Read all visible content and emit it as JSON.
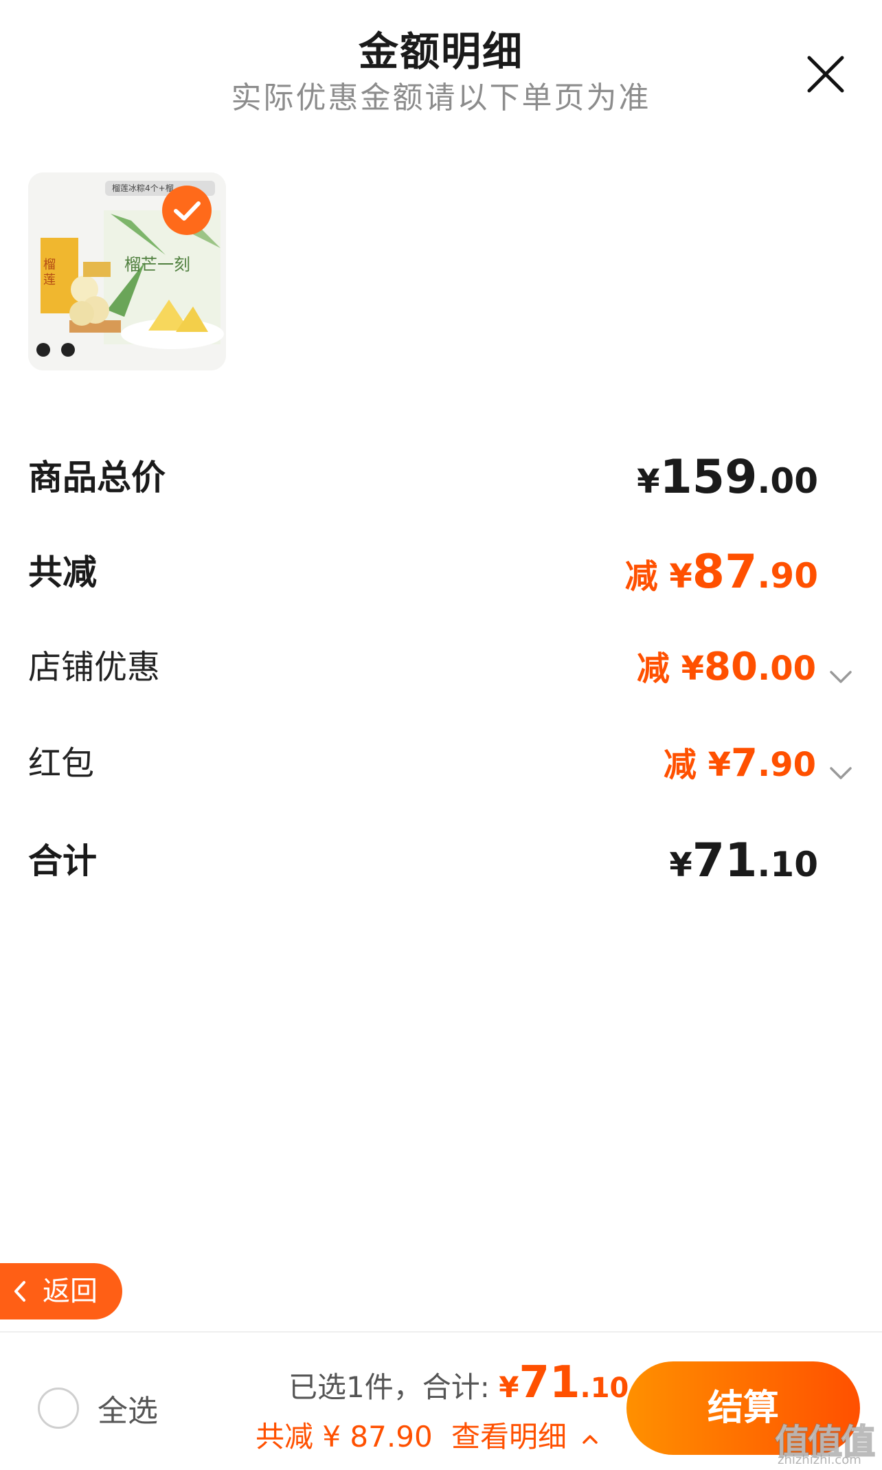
{
  "header": {
    "title": "金额明细",
    "subtitle": "实际优惠金额请以下单页为准"
  },
  "product": {
    "thumb_label": "榴莲冰粽4个+榴...",
    "selected": true
  },
  "rows": {
    "total_price": {
      "label": "商品总价",
      "currency": "¥",
      "int": "159",
      "dec": ".00"
    },
    "total_discount": {
      "label": "共减",
      "prefix": "减 ¥",
      "int": "87",
      "dec": ".90"
    },
    "shop_discount": {
      "label": "店铺优惠",
      "prefix": "减 ¥",
      "int": "80",
      "dec": ".00"
    },
    "red_packet": {
      "label": "红包",
      "prefix": "减 ¥",
      "int": "7",
      "dec": ".90"
    },
    "sum": {
      "label": "合计",
      "currency": "¥",
      "int": "71",
      "dec": ".10"
    }
  },
  "back_button": {
    "label": "返回"
  },
  "bottom": {
    "select_all": "全选",
    "selected_text": "已选1件，合计:",
    "currency": "¥",
    "total_int": "71",
    "total_dec": ".10",
    "discount_text": "共减 ¥ 87.90",
    "detail_link": "查看明细",
    "checkout": "结算"
  },
  "watermark": {
    "text": "值值值",
    "sub": "zhizhizhi.com"
  },
  "colors": {
    "accent": "#ff5000",
    "accent_light": "#ff9000"
  }
}
